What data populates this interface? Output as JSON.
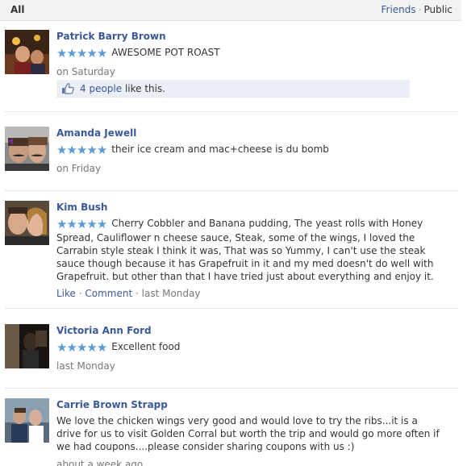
{
  "header": {
    "tab_all": "All",
    "filter_friends": "Friends",
    "filter_sep": "·",
    "filter_public": "Public"
  },
  "colors": {
    "link": "#3b5998",
    "star": "#5b9bd5",
    "muted": "#777777",
    "header_bg": "#f2f2f2"
  },
  "reviews": [
    {
      "name": "Patrick Barry Brown",
      "stars": 5,
      "text": "AWESOME POT ROAST",
      "time": "on Saturday",
      "likes_count": "4 people",
      "likes_suffix": " like this."
    },
    {
      "name": "Amanda Jewell",
      "stars": 5,
      "text": "their ice cream and mac+cheese is du bomb",
      "time": "on Friday"
    },
    {
      "name": "Kim Bush",
      "stars": 5,
      "text": "Cherry Cobbler and Banana pudding, The yeast rolls with Honey Spread, Cauliflower n cheese sauce, Steak, some of the wings, I loved the Carrabin style steak I think it was, That was so Yummy, I can't use the steak sauce though because it has Grapefruit in it and my med doesn't do well with Grapefruit. but other than that I have tried just about everything and enjoy it.",
      "like_label": "Like",
      "action_sep": " · ",
      "comment_label": "Comment",
      "time": "last Monday"
    },
    {
      "name": "Victoria Ann Ford",
      "stars": 5,
      "text": "Excellent food",
      "time": "last Monday"
    },
    {
      "name": "Carrie Brown Strapp",
      "text": "We love the chicken wings very good and would love to try the ribs...it is a drive for us to visit Golden Corral but worth the trip and would go more often if we had coupons....please consider sharing coupons with us :)",
      "time": "about a week ago"
    }
  ]
}
